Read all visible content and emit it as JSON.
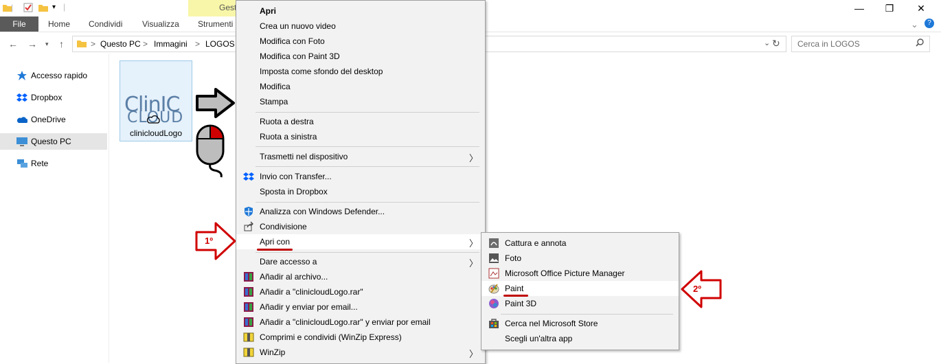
{
  "titlebar": {
    "contextual_tab": "Gest",
    "minimize": "—",
    "maximize": "❐",
    "close": "✕"
  },
  "ribbon": {
    "tabs": [
      "File",
      "Home",
      "Condividi",
      "Visualizza",
      "Strumenti"
    ],
    "expand": "⌄",
    "help": "?"
  },
  "address": {
    "crumbs": [
      "Questo PC",
      "Immagini",
      "LOGOS"
    ],
    "separator": ">",
    "search_placeholder": "Cerca in LOGOS"
  },
  "sidebar": {
    "items": [
      {
        "label": "Accesso rapido",
        "icon": "star-icon",
        "color": "#1e78d7"
      },
      {
        "label": "Dropbox",
        "icon": "dropbox-icon",
        "color": "#0061fe"
      },
      {
        "label": "OneDrive",
        "icon": "cloud-icon",
        "color": "#0a64c8"
      },
      {
        "label": "Questo PC",
        "icon": "computer-icon",
        "color": "#3c8fd6"
      },
      {
        "label": "Rete",
        "icon": "network-icon",
        "color": "#3c8fd6"
      }
    ]
  },
  "file": {
    "name": "clinicloudLogo",
    "logo_line1": "ClinIC",
    "logo_line2": "CLOUD"
  },
  "annotations": {
    "step1": "1º",
    "step2": "2º",
    "accent": "#d00000"
  },
  "context_menu": {
    "items": [
      {
        "label": "Apri"
      },
      {
        "label": "Crea un nuovo video"
      },
      {
        "label": "Modifica con Foto"
      },
      {
        "label": "Modifica con Paint 3D"
      },
      {
        "label": "Imposta come sfondo del desktop"
      },
      {
        "label": "Modifica"
      },
      {
        "label": "Stampa"
      },
      {
        "label": "Ruota a destra"
      },
      {
        "label": "Ruota a sinistra"
      },
      {
        "label": "Trasmetti nel dispositivo"
      },
      {
        "label": "Invio con Transfer..."
      },
      {
        "label": "Sposta in Dropbox"
      },
      {
        "label": "Analizza con Windows Defender..."
      },
      {
        "label": "Condivisione"
      },
      {
        "label": "Apri con"
      },
      {
        "label": "Dare accesso a"
      },
      {
        "label": "Añadir al archivo..."
      },
      {
        "label": "Añadir a \"clinicloudLogo.rar\""
      },
      {
        "label": "Añadir y enviar por email..."
      },
      {
        "label": "Añadir a \"clinicloudLogo.rar\" y enviar por email"
      },
      {
        "label": "Comprimi e condividi (WinZip Express)"
      },
      {
        "label": "WinZip"
      }
    ]
  },
  "submenu": {
    "items": [
      {
        "label": "Cattura e annota"
      },
      {
        "label": "Foto"
      },
      {
        "label": "Microsoft Office Picture Manager"
      },
      {
        "label": "Paint"
      },
      {
        "label": "Paint 3D"
      },
      {
        "label": "Cerca nel Microsoft Store"
      },
      {
        "label": "Scegli un'altra app"
      }
    ]
  }
}
